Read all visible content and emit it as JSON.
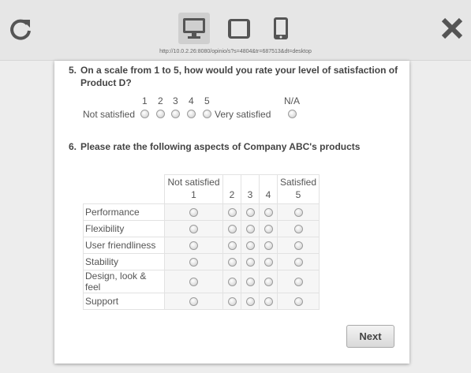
{
  "toolbar": {
    "url": "http://10.0.2.26:8080/opinio/s?s=4804&tr=687513&dt=desktop",
    "reload_icon": "reload-icon",
    "close_icon": "close-icon",
    "devices": [
      {
        "name": "desktop",
        "icon": "monitor-icon",
        "active": true
      },
      {
        "name": "tablet",
        "icon": "tablet-icon",
        "active": false
      },
      {
        "name": "phone",
        "icon": "phone-icon",
        "active": false
      }
    ]
  },
  "q5": {
    "number": "5.",
    "text_line1": "On a scale from 1 to 5, how would you rate your level of satisfaction of",
    "text_line2": "Product D?",
    "scale": [
      "1",
      "2",
      "3",
      "4",
      "5"
    ],
    "na_label": "N/A",
    "left_label": "Not satisfied",
    "right_label": "Very satisfied"
  },
  "q6": {
    "number": "6.",
    "text": "Please rate the following aspects of Company ABC's products",
    "columns": [
      {
        "top": "Not satisfied",
        "bottom": "1"
      },
      {
        "top": "",
        "bottom": "2"
      },
      {
        "top": "",
        "bottom": "3"
      },
      {
        "top": "",
        "bottom": "4"
      },
      {
        "top": "Satisfied",
        "bottom": "5"
      }
    ],
    "rows": [
      "Performance",
      "Flexibility",
      "User friendliness",
      "Stability",
      "Design, look & feel",
      "Support"
    ]
  },
  "next_label": "Next"
}
